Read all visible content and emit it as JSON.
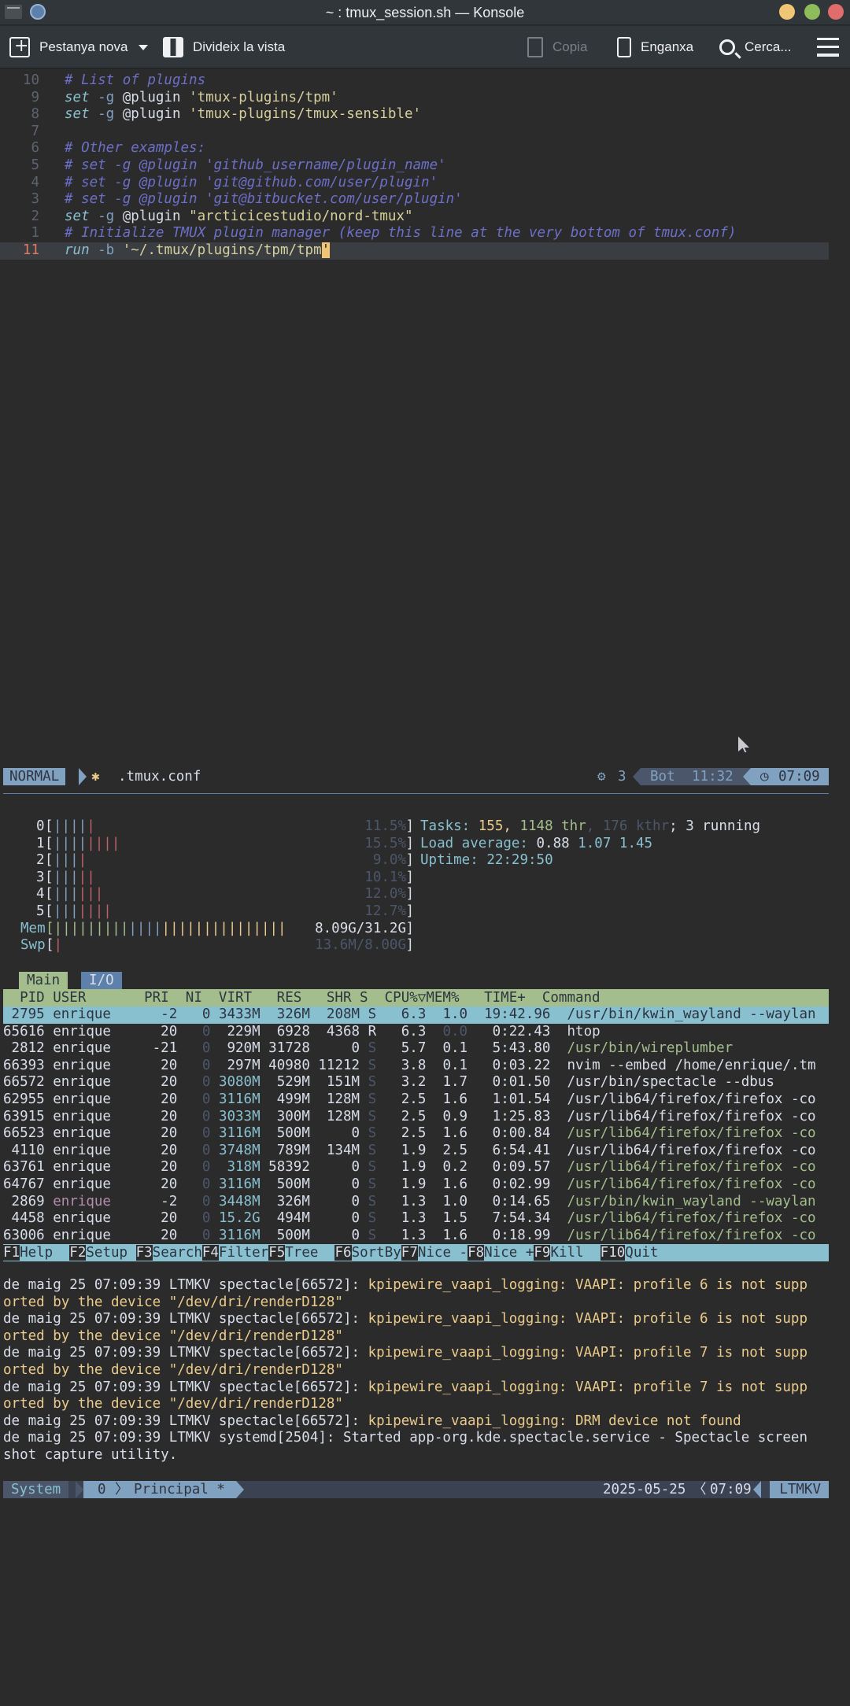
{
  "window": {
    "title": "~ : tmux_session.sh — Konsole"
  },
  "toolbar": {
    "new_tab": "Pestanya nova",
    "split": "Divideix la vista",
    "copy": "Copia",
    "paste": "Enganxa",
    "search": "Cerca..."
  },
  "editor": {
    "lines": [
      {
        "num": "10",
        "text": "# List of plugins"
      },
      {
        "num": "9",
        "text": "set -g @plugin 'tmux-plugins/tpm'"
      },
      {
        "num": "8",
        "text": "set -g @plugin 'tmux-plugins/tmux-sensible'"
      },
      {
        "num": "7",
        "text": ""
      },
      {
        "num": "6",
        "text": "# Other examples:"
      },
      {
        "num": "5",
        "text": "# set -g @plugin 'github_username/plugin_name'"
      },
      {
        "num": "4",
        "text": "# set -g @plugin 'git@github.com/user/plugin'"
      },
      {
        "num": "3",
        "text": "# set -g @plugin 'git@bitbucket.com/user/plugin'"
      },
      {
        "num": "2",
        "text": "set -g @plugin \"arcticicestudio/nord-tmux\""
      },
      {
        "num": "1",
        "text": "# Initialize TMUX plugin manager (keep this line at the very bottom of tmux.conf)"
      },
      {
        "num": "11",
        "text": "run -b '~/.tmux/plugins/tpm/tpm'"
      }
    ],
    "status": {
      "mode": "NORMAL",
      "file": ".tmux.conf",
      "count": "3",
      "position": "Bot",
      "cursor": "11:32",
      "clock": "07:09"
    }
  },
  "htop": {
    "cpus": [
      {
        "id": "0",
        "pct": "11.5%",
        "bars": "||||",
        "red": "|"
      },
      {
        "id": "1",
        "pct": "15.5%",
        "bars": "||||",
        "red": "||||"
      },
      {
        "id": "2",
        "pct": "9.0%",
        "bars": "|||",
        "red": "|"
      },
      {
        "id": "3",
        "pct": "10.1%",
        "bars": "|||",
        "red": "||"
      },
      {
        "id": "4",
        "pct": "12.0%",
        "bars": "|||",
        "red": "|||"
      },
      {
        "id": "5",
        "pct": "12.7%",
        "bars": "|||",
        "red": "||||"
      }
    ],
    "mem": {
      "label": "Mem",
      "value": "8.09G/31.2G"
    },
    "swp": {
      "label": "Swp",
      "value": "13.6M/8.00G"
    },
    "tasks": {
      "label": "Tasks:",
      "count": "155,",
      "thr": "1148 thr",
      "kthr": ", 176 kthr",
      "running": "; 3 running"
    },
    "load": {
      "label": "Load average:",
      "one": "0.88",
      "five": "1.07",
      "fifteen": "1.45"
    },
    "uptime": {
      "label": "Uptime:",
      "value": "22:29:50"
    },
    "tabs": [
      "Main",
      "I/O"
    ],
    "header": "  PID USER       PRI  NI  VIRT   RES   SHR S  CPU%▽MEM%   TIME+  Command",
    "processes": [
      {
        "pid": "2795",
        "user": "enrique",
        "pri": "-2",
        "ni": "0",
        "virt": "3433M",
        "res": "326M",
        "shr": "208M",
        "s": "S",
        "cpu": "6.3",
        "mem": "1.0",
        "time": "19:42.96",
        "cmd": "/usr/bin/kwin_wayland --waylan"
      },
      {
        "pid": "65616",
        "user": "enrique",
        "pri": "20",
        "ni": "0",
        "virt": "229M",
        "res": "6928",
        "shr": "4368",
        "s": "R",
        "cpu": "6.3",
        "mem": "0.0",
        "time": "0:22.43",
        "cmd": "htop"
      },
      {
        "pid": "2812",
        "user": "enrique",
        "pri": "-21",
        "ni": "0",
        "virt": "920M",
        "res": "31728",
        "shr": "0",
        "s": "S",
        "cpu": "5.7",
        "mem": "0.1",
        "time": "5:43.80",
        "cmd": "/usr/bin/wireplumber"
      },
      {
        "pid": "66393",
        "user": "enrique",
        "pri": "20",
        "ni": "0",
        "virt": "297M",
        "res": "40980",
        "shr": "11212",
        "s": "S",
        "cpu": "3.8",
        "mem": "0.1",
        "time": "0:03.22",
        "cmd": "nvim --embed /home/enrique/.tm"
      },
      {
        "pid": "66572",
        "user": "enrique",
        "pri": "20",
        "ni": "0",
        "virt": "3080M",
        "res": "529M",
        "shr": "151M",
        "s": "S",
        "cpu": "3.2",
        "mem": "1.7",
        "time": "0:01.50",
        "cmd": "/usr/bin/spectacle --dbus"
      },
      {
        "pid": "62955",
        "user": "enrique",
        "pri": "20",
        "ni": "0",
        "virt": "3116M",
        "res": "499M",
        "shr": "128M",
        "s": "S",
        "cpu": "2.5",
        "mem": "1.6",
        "time": "1:01.54",
        "cmd": "/usr/lib64/firefox/firefox -co"
      },
      {
        "pid": "63915",
        "user": "enrique",
        "pri": "20",
        "ni": "0",
        "virt": "3033M",
        "res": "300M",
        "shr": "128M",
        "s": "S",
        "cpu": "2.5",
        "mem": "0.9",
        "time": "1:25.83",
        "cmd": "/usr/lib64/firefox/firefox -co"
      },
      {
        "pid": "66523",
        "user": "enrique",
        "pri": "20",
        "ni": "0",
        "virt": "3116M",
        "res": "500M",
        "shr": "0",
        "s": "S",
        "cpu": "2.5",
        "mem": "1.6",
        "time": "0:00.84",
        "cmd": "/usr/lib64/firefox/firefox -co"
      },
      {
        "pid": "4110",
        "user": "enrique",
        "pri": "20",
        "ni": "0",
        "virt": "3748M",
        "res": "789M",
        "shr": "134M",
        "s": "S",
        "cpu": "1.9",
        "mem": "2.5",
        "time": "6:54.41",
        "cmd": "/usr/lib64/firefox/firefox -co"
      },
      {
        "pid": "63761",
        "user": "enrique",
        "pri": "20",
        "ni": "0",
        "virt": "318M",
        "res": "58392",
        "shr": "0",
        "s": "S",
        "cpu": "1.9",
        "mem": "0.2",
        "time": "0:09.57",
        "cmd": "/usr/lib64/firefox/firefox -co"
      },
      {
        "pid": "64767",
        "user": "enrique",
        "pri": "20",
        "ni": "0",
        "virt": "3116M",
        "res": "500M",
        "shr": "0",
        "s": "S",
        "cpu": "1.9",
        "mem": "1.6",
        "time": "0:02.99",
        "cmd": "/usr/lib64/firefox/firefox -co"
      },
      {
        "pid": "2869",
        "user": "enrique",
        "pri": "-2",
        "ni": "0",
        "virt": "3448M",
        "res": "326M",
        "shr": "0",
        "s": "S",
        "cpu": "1.3",
        "mem": "1.0",
        "time": "0:14.65",
        "cmd": "/usr/bin/kwin_wayland --waylan"
      },
      {
        "pid": "4458",
        "user": "enrique",
        "pri": "20",
        "ni": "0",
        "virt": "15.2G",
        "res": "494M",
        "shr": "0",
        "s": "S",
        "cpu": "1.3",
        "mem": "1.5",
        "time": "7:54.34",
        "cmd": "/usr/lib64/firefox/firefox -co"
      },
      {
        "pid": "63006",
        "user": "enrique",
        "pri": "20",
        "ni": "0",
        "virt": "3116M",
        "res": "500M",
        "shr": "0",
        "s": "S",
        "cpu": "1.3",
        "mem": "1.6",
        "time": "0:18.99",
        "cmd": "/usr/lib64/firefox/firefox -co"
      }
    ],
    "fkeys": [
      {
        "key": "F1",
        "label": "Help  "
      },
      {
        "key": "F2",
        "label": "Setup "
      },
      {
        "key": "F3",
        "label": "Search"
      },
      {
        "key": "F4",
        "label": "Filter"
      },
      {
        "key": "F5",
        "label": "Tree  "
      },
      {
        "key": "F6",
        "label": "SortBy"
      },
      {
        "key": "F7",
        "label": "Nice -"
      },
      {
        "key": "F8",
        "label": "Nice +"
      },
      {
        "key": "F9",
        "label": "Kill  "
      },
      {
        "key": "F10",
        "label": "Quit"
      }
    ]
  },
  "logs": [
    {
      "prefix": "de maig 25 07:09:39 LTMKV spectacle[66572]: ",
      "msg": "kpipewire_vaapi_logging: VAAPI: profile 6 is not supp",
      "cont": "orted by the device \"/dev/dri/renderD128\""
    },
    {
      "prefix": "de maig 25 07:09:39 LTMKV spectacle[66572]: ",
      "msg": "kpipewire_vaapi_logging: VAAPI: profile 6 is not supp",
      "cont": "orted by the device \"/dev/dri/renderD128\""
    },
    {
      "prefix": "de maig 25 07:09:39 LTMKV spectacle[66572]: ",
      "msg": "kpipewire_vaapi_logging: VAAPI: profile 7 is not supp",
      "cont": "orted by the device \"/dev/dri/renderD128\""
    },
    {
      "prefix": "de maig 25 07:09:39 LTMKV spectacle[66572]: ",
      "msg": "kpipewire_vaapi_logging: VAAPI: profile 7 is not supp",
      "cont": "orted by the device \"/dev/dri/renderD128\""
    },
    {
      "prefix": "de maig 25 07:09:39 LTMKV spectacle[66572]: ",
      "msg": "kpipewire_vaapi_logging: DRM device not found",
      "cont": ""
    },
    {
      "prefix": "de maig 25 07:09:39 LTMKV systemd[2504]: Started app-org.kde.spectacle.service - Spectacle screen",
      "msg": "",
      "cont": "shot capture utility."
    }
  ],
  "tmux": {
    "session": "System",
    "window_index": "0",
    "window_name": "Principal *",
    "date": "2025-05-25",
    "time": "07:09",
    "host": "LTMKV"
  },
  "colors": {
    "nord_frost": "#88c0d0",
    "nord_blue": "#81a1c1",
    "nord_green": "#a3be8c",
    "nord_yellow": "#ebcb8b",
    "nord_red": "#bf616a",
    "titlebar": "#31363b"
  }
}
